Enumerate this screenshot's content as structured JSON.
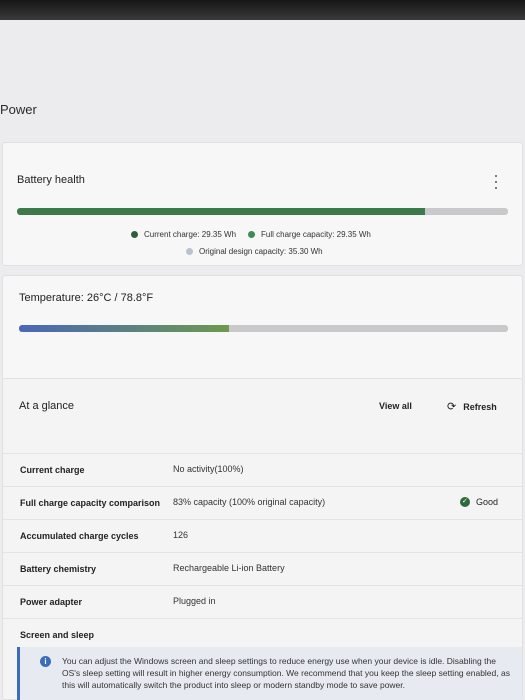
{
  "page": {
    "title": "Power"
  },
  "battery_health": {
    "title": "Battery health",
    "current_charge_label": "Current charge: 29.35 Wh",
    "full_capacity_label": "Full charge capacity: 29.35 Wh",
    "design_capacity_label": "Original design capacity: 35.30 Wh",
    "bar_fraction": 0.83,
    "colors": {
      "fill": "#3d7a4b",
      "current_dot": "#2f5f3a",
      "full_dot": "#3f8a55",
      "design_dot": "#b9c3d0"
    }
  },
  "temperature": {
    "title": "Temperature: 26°C / 78.8°F",
    "bar_fraction": 0.43,
    "colors": {
      "start": "#4a66b8",
      "end": "#6c9a4f"
    }
  },
  "at_a_glance": {
    "title": "At a glance",
    "view_all_label": "View all",
    "refresh_label": "Refresh",
    "refresh_icon": "refresh-icon",
    "rows": [
      {
        "label": "Current charge",
        "value": "No activity(100%)"
      },
      {
        "label": "Full charge capacity comparison",
        "value": "83% capacity (100% original capacity)",
        "status": "Good",
        "status_color": "#2e6b3a"
      },
      {
        "label": "Accumulated charge cycles",
        "value": "126"
      },
      {
        "label": "Battery chemistry",
        "value": "Rechargeable Li-ion Battery"
      },
      {
        "label": "Power adapter",
        "value": "Plugged in"
      },
      {
        "label": "Screen and sleep",
        "value": ""
      }
    ],
    "info_text": "You can adjust the Windows screen and sleep settings to reduce energy use when your device is idle. Disabling the OS's sleep setting will result in higher energy consumption. We recommend that you keep the sleep setting enabled, as this will automatically switch the product into sleep or modern standby mode to save power.",
    "info_icon": "info-icon"
  }
}
